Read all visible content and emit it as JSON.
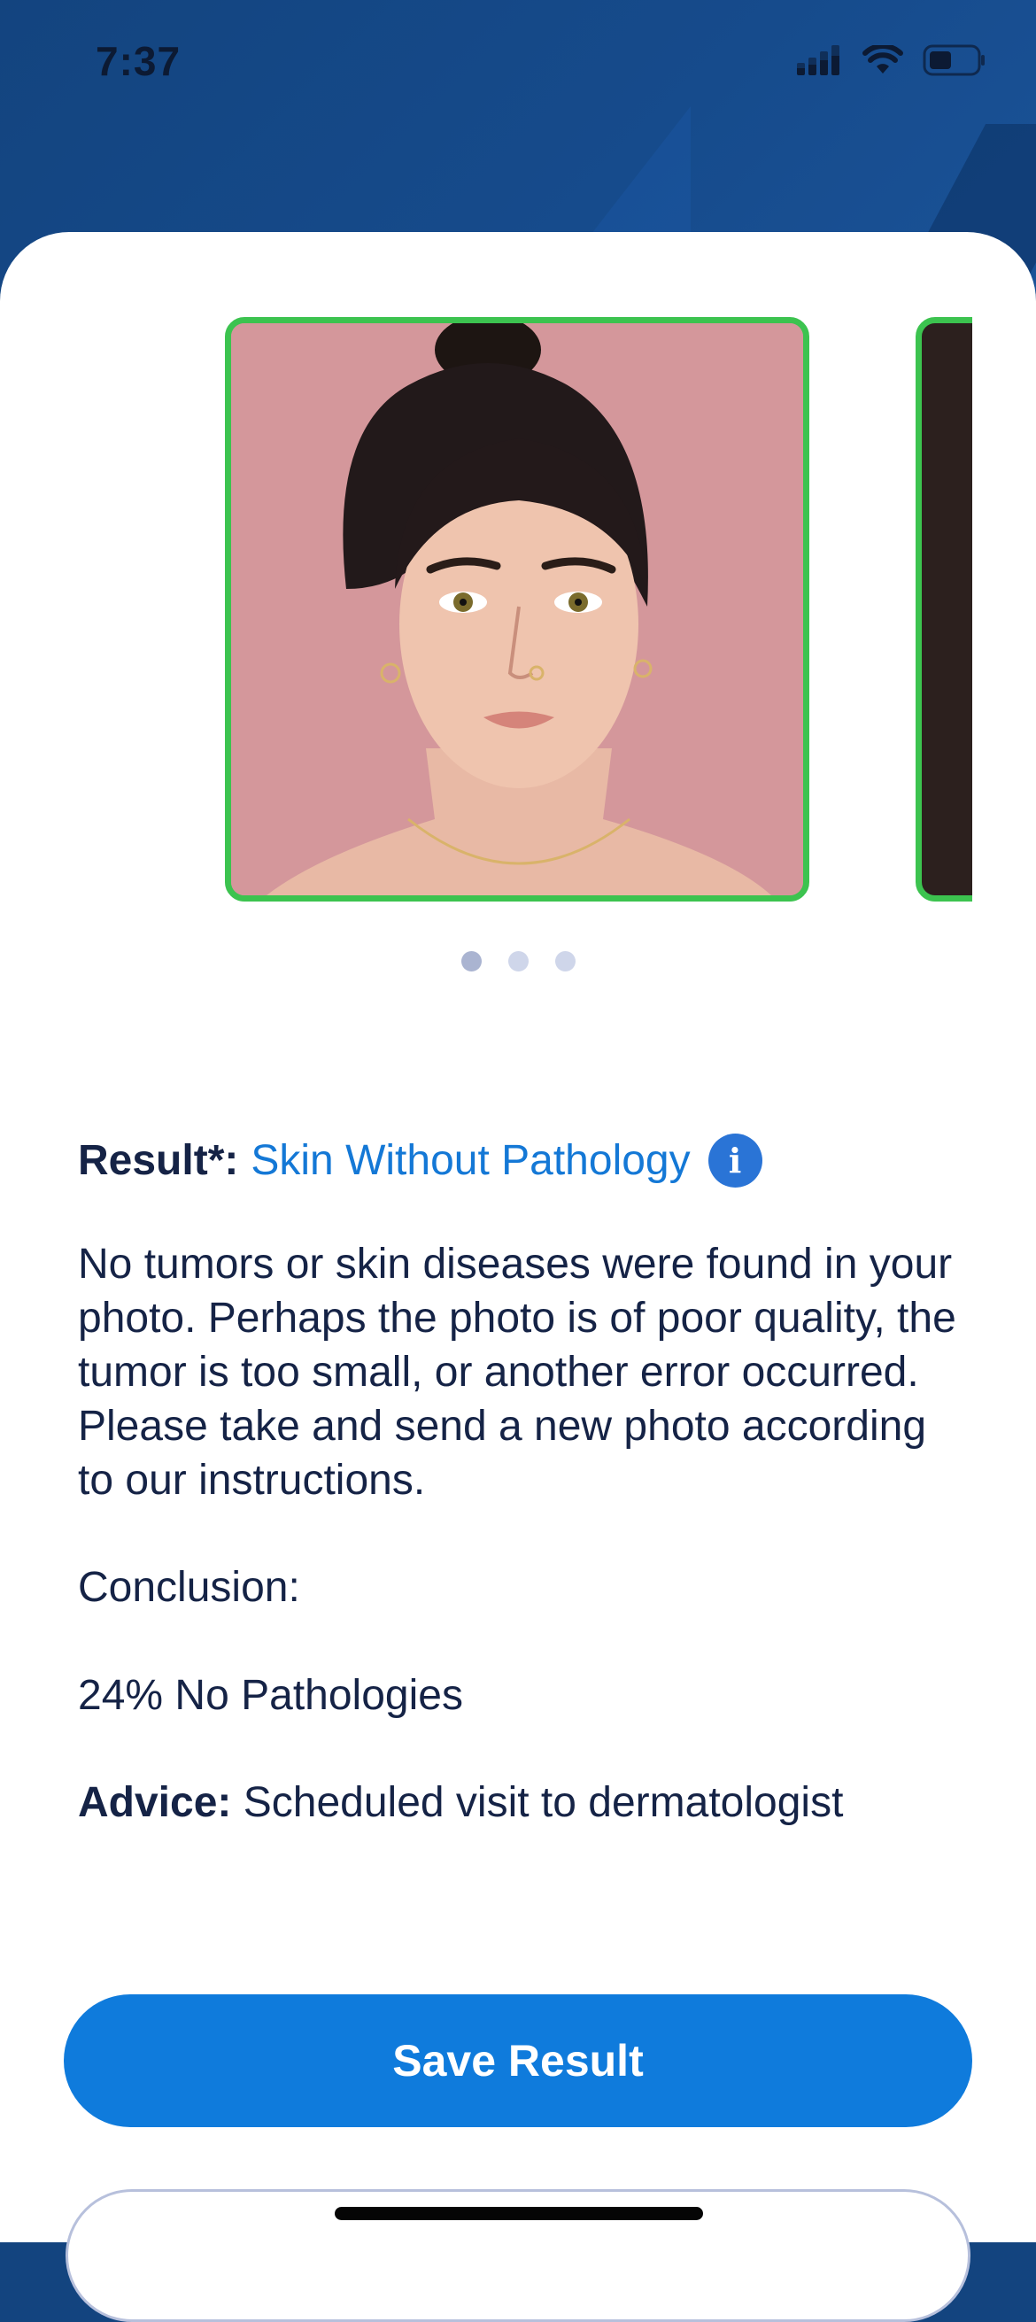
{
  "status_bar": {
    "time": "7:37"
  },
  "carousel": {
    "slides": [
      "face-photo",
      "second-photo"
    ],
    "page_count": 3,
    "active_index": 0,
    "border_color": "#3cc34f"
  },
  "result": {
    "label": "Result*:",
    "value": "Skin Without Pathology",
    "info_icon": "info-icon"
  },
  "description": "No tumors or skin diseases were found in your photo. Perhaps the photo is of poor quality, the tumor is too small, or another error occurred. Please take and send a new photo according to our instructions.",
  "conclusion": {
    "label": "Conclusion:",
    "value": "24% No Pathologies"
  },
  "advice": {
    "label": "Advice:",
    "value": " Scheduled visit to dermatologist"
  },
  "actions": {
    "save_label": "Save Result"
  },
  "colors": {
    "accent": "#0f7bdc",
    "link": "#1478d6",
    "header": "#13447f",
    "success": "#3cc34f"
  }
}
